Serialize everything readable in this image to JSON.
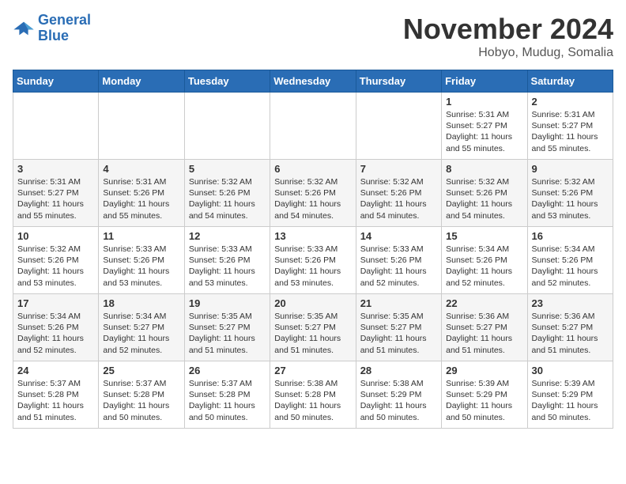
{
  "logo": {
    "line1": "General",
    "line2": "Blue"
  },
  "header": {
    "month": "November 2024",
    "location": "Hobyo, Mudug, Somalia"
  },
  "weekdays": [
    "Sunday",
    "Monday",
    "Tuesday",
    "Wednesday",
    "Thursday",
    "Friday",
    "Saturday"
  ],
  "weeks": [
    [
      {
        "day": "",
        "info": ""
      },
      {
        "day": "",
        "info": ""
      },
      {
        "day": "",
        "info": ""
      },
      {
        "day": "",
        "info": ""
      },
      {
        "day": "",
        "info": ""
      },
      {
        "day": "1",
        "info": "Sunrise: 5:31 AM\nSunset: 5:27 PM\nDaylight: 11 hours\nand 55 minutes."
      },
      {
        "day": "2",
        "info": "Sunrise: 5:31 AM\nSunset: 5:27 PM\nDaylight: 11 hours\nand 55 minutes."
      }
    ],
    [
      {
        "day": "3",
        "info": "Sunrise: 5:31 AM\nSunset: 5:27 PM\nDaylight: 11 hours\nand 55 minutes."
      },
      {
        "day": "4",
        "info": "Sunrise: 5:31 AM\nSunset: 5:26 PM\nDaylight: 11 hours\nand 55 minutes."
      },
      {
        "day": "5",
        "info": "Sunrise: 5:32 AM\nSunset: 5:26 PM\nDaylight: 11 hours\nand 54 minutes."
      },
      {
        "day": "6",
        "info": "Sunrise: 5:32 AM\nSunset: 5:26 PM\nDaylight: 11 hours\nand 54 minutes."
      },
      {
        "day": "7",
        "info": "Sunrise: 5:32 AM\nSunset: 5:26 PM\nDaylight: 11 hours\nand 54 minutes."
      },
      {
        "day": "8",
        "info": "Sunrise: 5:32 AM\nSunset: 5:26 PM\nDaylight: 11 hours\nand 54 minutes."
      },
      {
        "day": "9",
        "info": "Sunrise: 5:32 AM\nSunset: 5:26 PM\nDaylight: 11 hours\nand 53 minutes."
      }
    ],
    [
      {
        "day": "10",
        "info": "Sunrise: 5:32 AM\nSunset: 5:26 PM\nDaylight: 11 hours\nand 53 minutes."
      },
      {
        "day": "11",
        "info": "Sunrise: 5:33 AM\nSunset: 5:26 PM\nDaylight: 11 hours\nand 53 minutes."
      },
      {
        "day": "12",
        "info": "Sunrise: 5:33 AM\nSunset: 5:26 PM\nDaylight: 11 hours\nand 53 minutes."
      },
      {
        "day": "13",
        "info": "Sunrise: 5:33 AM\nSunset: 5:26 PM\nDaylight: 11 hours\nand 53 minutes."
      },
      {
        "day": "14",
        "info": "Sunrise: 5:33 AM\nSunset: 5:26 PM\nDaylight: 11 hours\nand 52 minutes."
      },
      {
        "day": "15",
        "info": "Sunrise: 5:34 AM\nSunset: 5:26 PM\nDaylight: 11 hours\nand 52 minutes."
      },
      {
        "day": "16",
        "info": "Sunrise: 5:34 AM\nSunset: 5:26 PM\nDaylight: 11 hours\nand 52 minutes."
      }
    ],
    [
      {
        "day": "17",
        "info": "Sunrise: 5:34 AM\nSunset: 5:26 PM\nDaylight: 11 hours\nand 52 minutes."
      },
      {
        "day": "18",
        "info": "Sunrise: 5:34 AM\nSunset: 5:27 PM\nDaylight: 11 hours\nand 52 minutes."
      },
      {
        "day": "19",
        "info": "Sunrise: 5:35 AM\nSunset: 5:27 PM\nDaylight: 11 hours\nand 51 minutes."
      },
      {
        "day": "20",
        "info": "Sunrise: 5:35 AM\nSunset: 5:27 PM\nDaylight: 11 hours\nand 51 minutes."
      },
      {
        "day": "21",
        "info": "Sunrise: 5:35 AM\nSunset: 5:27 PM\nDaylight: 11 hours\nand 51 minutes."
      },
      {
        "day": "22",
        "info": "Sunrise: 5:36 AM\nSunset: 5:27 PM\nDaylight: 11 hours\nand 51 minutes."
      },
      {
        "day": "23",
        "info": "Sunrise: 5:36 AM\nSunset: 5:27 PM\nDaylight: 11 hours\nand 51 minutes."
      }
    ],
    [
      {
        "day": "24",
        "info": "Sunrise: 5:37 AM\nSunset: 5:28 PM\nDaylight: 11 hours\nand 51 minutes."
      },
      {
        "day": "25",
        "info": "Sunrise: 5:37 AM\nSunset: 5:28 PM\nDaylight: 11 hours\nand 50 minutes."
      },
      {
        "day": "26",
        "info": "Sunrise: 5:37 AM\nSunset: 5:28 PM\nDaylight: 11 hours\nand 50 minutes."
      },
      {
        "day": "27",
        "info": "Sunrise: 5:38 AM\nSunset: 5:28 PM\nDaylight: 11 hours\nand 50 minutes."
      },
      {
        "day": "28",
        "info": "Sunrise: 5:38 AM\nSunset: 5:29 PM\nDaylight: 11 hours\nand 50 minutes."
      },
      {
        "day": "29",
        "info": "Sunrise: 5:39 AM\nSunset: 5:29 PM\nDaylight: 11 hours\nand 50 minutes."
      },
      {
        "day": "30",
        "info": "Sunrise: 5:39 AM\nSunset: 5:29 PM\nDaylight: 11 hours\nand 50 minutes."
      }
    ]
  ]
}
